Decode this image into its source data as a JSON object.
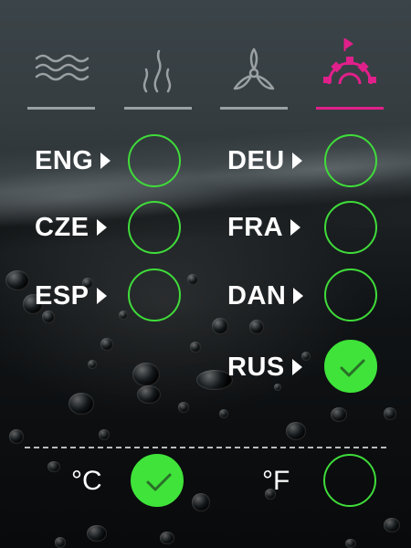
{
  "tabs": [
    {
      "name": "water",
      "icon": "waves-icon",
      "active": false
    },
    {
      "name": "heat",
      "icon": "steam-icon",
      "active": false
    },
    {
      "name": "fan",
      "icon": "fan-icon",
      "active": false
    },
    {
      "name": "settings",
      "icon": "gear-flag-icon",
      "active": true
    }
  ],
  "languages": [
    {
      "code": "ENG",
      "selected": false
    },
    {
      "code": "DEU",
      "selected": false
    },
    {
      "code": "CZE",
      "selected": false
    },
    {
      "code": "FRA",
      "selected": false
    },
    {
      "code": "ESP",
      "selected": false
    },
    {
      "code": "DAN",
      "selected": false
    },
    {
      "code": "RUS",
      "selected": true
    }
  ],
  "units": [
    {
      "label": "°C",
      "selected": true
    },
    {
      "label": "°F",
      "selected": false
    }
  ],
  "colors": {
    "accent_active": "#e0208a",
    "radio_green": "#3fdc3a",
    "tab_inactive": "#9aa0a3"
  }
}
